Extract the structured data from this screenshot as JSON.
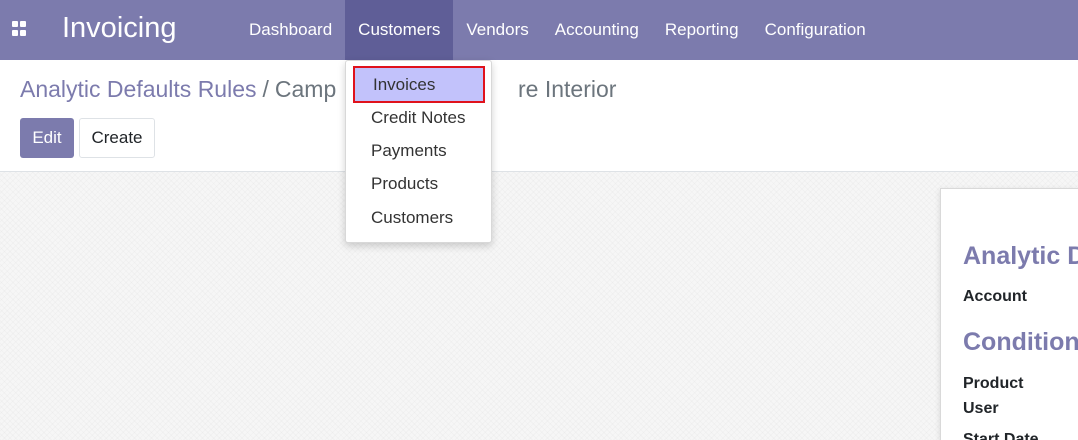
{
  "navbar": {
    "app_title": "Invoicing",
    "menu": [
      {
        "label": "Dashboard"
      },
      {
        "label": "Customers"
      },
      {
        "label": "Vendors"
      },
      {
        "label": "Accounting"
      },
      {
        "label": "Reporting"
      },
      {
        "label": "Configuration"
      }
    ],
    "active_menu": "Customers",
    "icon": "apps-grid-icon"
  },
  "breadcrumb": {
    "parent": "Analytic Defaults Rules",
    "separator": "/",
    "current": "Camp",
    "current_tail": "re Interior"
  },
  "buttons": {
    "edit": "Edit",
    "create": "Create"
  },
  "dropdown": {
    "items": [
      {
        "label": "Invoices",
        "highlighted": true
      },
      {
        "label": "Credit Notes"
      },
      {
        "label": "Payments"
      },
      {
        "label": "Products"
      },
      {
        "label": "Customers"
      }
    ]
  },
  "form": {
    "section_analytic": "Analytic D",
    "account_label": "Account",
    "section_conditions": "Condition",
    "product_label": "Product",
    "user_label": "User",
    "start_date_label": "Start Date"
  },
  "colors": {
    "navbar": "#7c7bad",
    "active_menu": "#5f5e97",
    "highlight_bg": "#c2c2fb",
    "highlight_border": "#e0121c"
  }
}
